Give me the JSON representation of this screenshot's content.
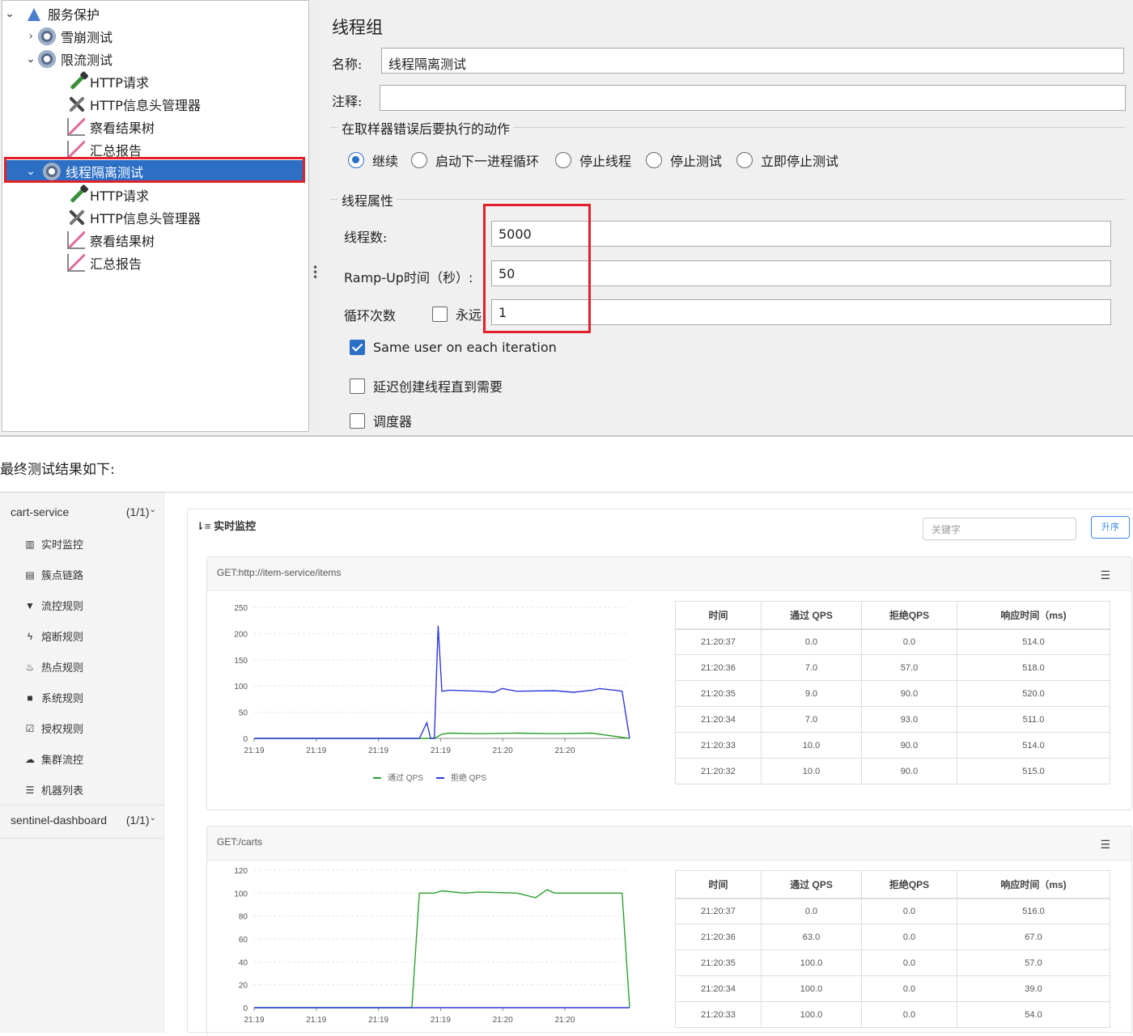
{
  "jmeter": {
    "tree": {
      "root": "服务保护",
      "n1": "雪崩测试",
      "n2": "限流测试",
      "n2_children": [
        "HTTP请求",
        "HTTP信息头管理器",
        "察看结果树",
        "汇总报告"
      ],
      "n3": "线程隔离测试",
      "n3_children": [
        "HTTP请求",
        "HTTP信息头管理器",
        "察看结果树",
        "汇总报告"
      ]
    },
    "panel": {
      "title": "线程组",
      "name_label": "名称:",
      "name_value": "线程隔离测试",
      "comment_label": "注释:",
      "comment_value": "",
      "error_section": "在取样器错误后要执行的动作",
      "error_options": [
        "继续",
        "启动下一进程循环",
        "停止线程",
        "停止测试",
        "立即停止测试"
      ],
      "error_selected": "继续",
      "thread_section": "线程属性",
      "threads_label": "线程数:",
      "threads_value": "5000",
      "ramp_label": "Ramp-Up时间（秒）:",
      "ramp_value": "50",
      "loop_label": "循环次数",
      "forever_label": "永远",
      "forever_checked": false,
      "loop_value": "1",
      "same_user_label": "Same user on each iteration",
      "same_user_checked": true,
      "delay_label": "延迟创建线程直到需要",
      "delay_checked": false,
      "scheduler_label": "调度器",
      "scheduler_checked": false
    }
  },
  "caption": "最终测试结果如下:",
  "dashboard": {
    "apps": [
      {
        "name": "cart-service",
        "count": "(1/1)"
      },
      {
        "name": "sentinel-dashboard",
        "count": "(1/1)"
      }
    ],
    "menu": [
      {
        "icon": "bar-chart-icon",
        "label": "实时监控"
      },
      {
        "icon": "list-icon",
        "label": "簇点链路"
      },
      {
        "icon": "filter-icon",
        "label": "流控规则"
      },
      {
        "icon": "bolt-icon",
        "label": "熔断规则"
      },
      {
        "icon": "fire-icon",
        "label": "热点规则"
      },
      {
        "icon": "lock-icon",
        "label": "系统规则"
      },
      {
        "icon": "check-icon",
        "label": "授权规则"
      },
      {
        "icon": "cloud-icon",
        "label": "集群流控"
      },
      {
        "icon": "table-icon",
        "label": "机器列表"
      }
    ],
    "main_title": "实时监控",
    "search_placeholder": "关键字",
    "sort_button": "升序",
    "table_headers": [
      "时间",
      "通过 QPS",
      "拒绝QPS",
      "响应时间（ms)"
    ],
    "legend": [
      "通过 QPS",
      "拒绝 QPS"
    ],
    "colors": {
      "pass": "#2ca02c",
      "reject": "#2f3ad8"
    },
    "resources": [
      {
        "name": "GET:http://item-service/items",
        "rows": [
          [
            "21:20:37",
            "0.0",
            "0.0",
            "514.0"
          ],
          [
            "21:20:36",
            "7.0",
            "57.0",
            "518.0"
          ],
          [
            "21:20:35",
            "9.0",
            "90.0",
            "520.0"
          ],
          [
            "21:20:34",
            "7.0",
            "93.0",
            "511.0"
          ],
          [
            "21:20:33",
            "10.0",
            "90.0",
            "514.0"
          ],
          [
            "21:20:32",
            "10.0",
            "90.0",
            "515.0"
          ]
        ]
      },
      {
        "name": "GET:/carts",
        "rows": [
          [
            "21:20:37",
            "0.0",
            "0.0",
            "516.0"
          ],
          [
            "21:20:36",
            "63.0",
            "0.0",
            "67.0"
          ],
          [
            "21:20:35",
            "100.0",
            "0.0",
            "57.0"
          ],
          [
            "21:20:34",
            "100.0",
            "0.0",
            "39.0"
          ],
          [
            "21:20:33",
            "100.0",
            "0.0",
            "54.0"
          ]
        ]
      }
    ]
  },
  "chart_data": [
    {
      "type": "line",
      "ylim": [
        0,
        250
      ],
      "yticks": [
        0,
        50,
        100,
        150,
        200,
        250
      ],
      "xticks": [
        "21:19",
        "21:19",
        "21:19",
        "21:19",
        "21:20",
        "21:20"
      ],
      "series": [
        {
          "name": "通过 QPS",
          "color": "#2ca02c",
          "x": [
            0,
            48,
            50,
            52,
            60,
            70,
            80,
            90,
            100
          ],
          "values": [
            0,
            0,
            8,
            10,
            9,
            10,
            9,
            10,
            0
          ]
        },
        {
          "name": "拒绝 QPS",
          "color": "#2f3ad8",
          "x": [
            0,
            44,
            46,
            47,
            48,
            49,
            50,
            52,
            60,
            64,
            66,
            70,
            80,
            85,
            90,
            92,
            96,
            98,
            100
          ],
          "values": [
            0,
            0,
            30,
            0,
            0,
            215,
            90,
            92,
            90,
            88,
            95,
            90,
            91,
            88,
            92,
            95,
            92,
            90,
            0
          ]
        }
      ]
    },
    {
      "type": "line",
      "ylim": [
        0,
        120
      ],
      "yticks": [
        0,
        20,
        40,
        60,
        80,
        100,
        120
      ],
      "xticks": [
        "21:19",
        "21:19",
        "21:19",
        "21:19",
        "21:20",
        "21:20"
      ],
      "series": [
        {
          "name": "通过 QPS",
          "color": "#2ca02c",
          "x": [
            0,
            42,
            44,
            48,
            50,
            56,
            60,
            70,
            75,
            78,
            80,
            88,
            96,
            98,
            100
          ],
          "values": [
            0,
            0,
            100,
            100,
            102,
            100,
            101,
            100,
            96,
            103,
            100,
            100,
            100,
            100,
            0
          ]
        },
        {
          "name": "拒绝 QPS",
          "color": "#2f3ad8",
          "x": [
            0,
            100
          ],
          "values": [
            0,
            0
          ]
        }
      ]
    }
  ]
}
